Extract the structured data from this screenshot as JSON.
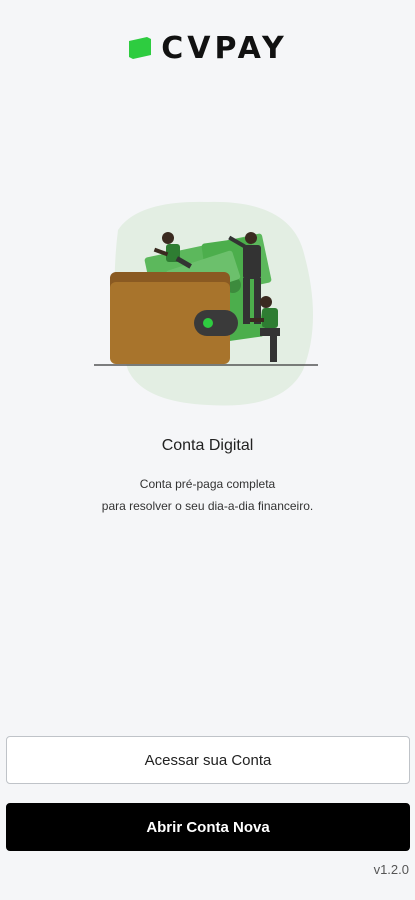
{
  "brand": {
    "name": "CVPAY",
    "accent_color": "#2ecc40"
  },
  "hero": {
    "title": "Conta Digital",
    "subtitle_line1": "Conta pré-paga completa",
    "subtitle_line2": "para resolver o seu dia-a-dia financeiro."
  },
  "actions": {
    "login_label": "Acessar sua Conta",
    "signup_label": "Abrir Conta Nova"
  },
  "footer": {
    "version": "v1.2.0"
  },
  "icons": {
    "logo_mark": "cvpay-logo-icon",
    "illustration": "wallet-money-illustration"
  }
}
